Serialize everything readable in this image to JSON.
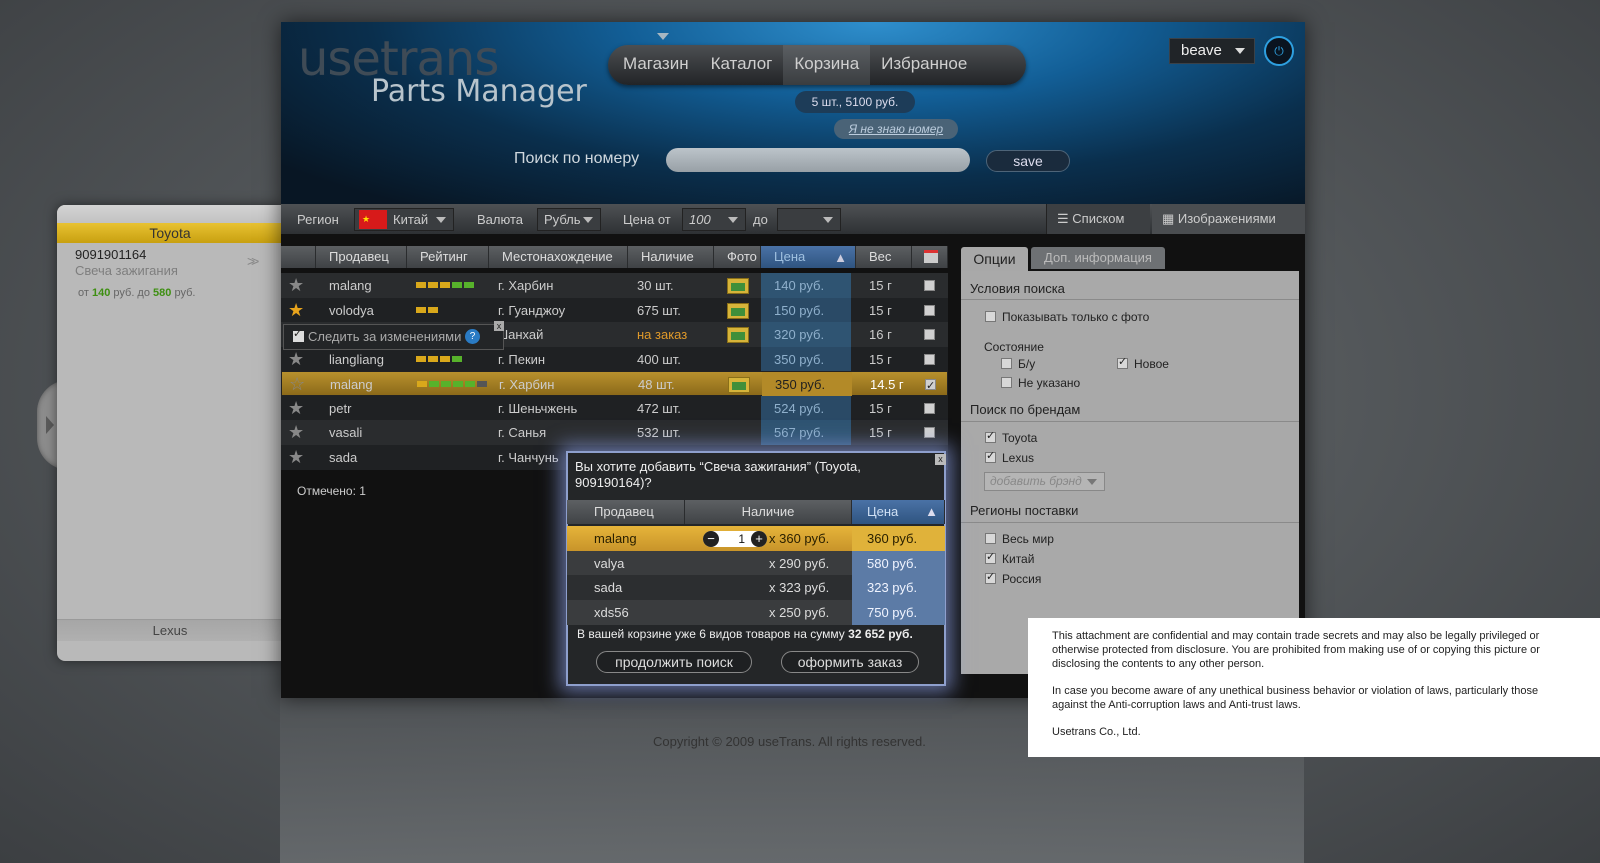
{
  "brand": {
    "logo_main": "usetrans",
    "logo_sub": "Parts Manager"
  },
  "nav": {
    "items": [
      "Магазин",
      "Каталог",
      "Корзина",
      "Избранное"
    ],
    "active": 2
  },
  "cart_summary": "5 шт., 5100 руб.",
  "dont_know_link": "Я не знаю номер",
  "search": {
    "label": "Поиск по номеру",
    "value": "",
    "button": "save"
  },
  "user": {
    "name": "beave"
  },
  "power_icon": "power-icon",
  "filters": {
    "region_label": "Регион",
    "region_value": "Китай",
    "currency_label": "Валюта",
    "currency_value": "Рубль",
    "price_from_label": "Цена от",
    "price_from_value": "100",
    "price_to_label": "до",
    "price_to_value": ""
  },
  "views": {
    "list": "Списком",
    "images": "Изображениями"
  },
  "results": {
    "columns": [
      "Продавец",
      "Рейтинг",
      "Местонахождение",
      "Наличие",
      "Фото",
      "Цена",
      "Вес"
    ],
    "rows": [
      {
        "seller": "malang",
        "rating": 5,
        "location": "г. Харбин",
        "stock": "30 шт.",
        "photo": true,
        "price": "140 руб.",
        "weight": "15 г",
        "checked": false,
        "fav": false
      },
      {
        "seller": "volodya",
        "rating": 2,
        "location": "г. Гуанджоу",
        "stock": "675 шт.",
        "photo": true,
        "price": "150 руб.",
        "weight": "15 г",
        "checked": false,
        "fav": true
      },
      {
        "seller": "",
        "rating": 0,
        "location": ". Шанхай",
        "stock": "на заказ",
        "photo": true,
        "price": "320 руб.",
        "weight": "16 г",
        "checked": false,
        "fav": false
      },
      {
        "seller": "liangliang",
        "rating": 4,
        "location": "г. Пекин",
        "stock": "400 шт.",
        "photo": false,
        "price": "350 руб.",
        "weight": "15 г",
        "checked": false,
        "fav": false
      },
      {
        "seller": "malang",
        "rating": 5,
        "location": "г. Харбин",
        "stock": "48 шт.",
        "photo": true,
        "price": "350 руб.",
        "weight": "14.5 г",
        "checked": true,
        "fav": false
      },
      {
        "seller": "petr",
        "rating": 0,
        "location": "г. Шеньчжень",
        "stock": "472 шт.",
        "photo": false,
        "price": "524 руб.",
        "weight": "15 г",
        "checked": false,
        "fav": false
      },
      {
        "seller": "vasali",
        "rating": 0,
        "location": "г. Санья",
        "stock": "532 шт.",
        "photo": false,
        "price": "567 руб.",
        "weight": "15 г",
        "checked": false,
        "fav": false
      },
      {
        "seller": "sada",
        "rating": 0,
        "location": "г. Чанчунь",
        "stock": "",
        "photo": false,
        "price": "",
        "weight": "",
        "checked": false,
        "fav": false
      }
    ],
    "marked_label": "Отмечено:",
    "marked_count": "1"
  },
  "watch": {
    "label": "Следить за изменениями",
    "help": "?",
    "close": "x"
  },
  "left_panel": {
    "brand": "Toyota",
    "part_number": "9091901164",
    "part_name": "Свеча зажигания",
    "price_from": "от",
    "price_min": "140",
    "price_mid": "руб. до",
    "price_max": "580",
    "price_unit": "руб.",
    "next_brand": "Lexus",
    "arrow": ">>"
  },
  "options": {
    "tabs": [
      "Опции",
      "Доп. информация"
    ],
    "search_conditions": "Условия поиска",
    "only_photo": "Показывать только с фото",
    "condition": "Состояние",
    "used": "Б/у",
    "new": "Новое",
    "unspecified": "Не указано",
    "brand_search": "Поиск по брендам",
    "brands": [
      "Toyota",
      "Lexus"
    ],
    "add_brand": "добавить брэнд",
    "regions": "Регионы поставки",
    "region_list": [
      "Весь мир",
      "Китай",
      "Россия"
    ]
  },
  "dialog": {
    "title": "Вы хотите добавить “Свеча зажигания” (Toyota, 909190164)?",
    "columns": [
      "Продавец",
      "Наличие",
      "Цена"
    ],
    "rows": [
      {
        "seller": "malang",
        "qty": "1",
        "unit": "x 360 руб.",
        "price": "360 руб."
      },
      {
        "seller": "valya",
        "unit": "x 290 руб.",
        "price": "580 руб."
      },
      {
        "seller": "sada",
        "unit": "x 323 руб.",
        "price": "323 руб."
      },
      {
        "seller": "xds56",
        "unit": "x 250 руб.",
        "price": "750 руб."
      }
    ],
    "summary_text": "В вашей корзине уже 6 видов товаров на сумму",
    "summary_total": "32 652 руб.",
    "continue": "продолжить поиск",
    "checkout": "оформить заказ",
    "close": "x"
  },
  "copyright": "Copyright © 2009 useTrans. All rights reserved.",
  "notice": {
    "p1": "This attachment are confidential and may contain trade secrets and may also be legally privileged or otherwise protected from disclosure. You are prohibited from making use of or copying this picture or disclosing the contents to any other person.",
    "p2": "In case you become aware of any unethical business behavior or violation of laws, particularly those against the Anti-corruption laws and Anti-trust laws.",
    "p3": "Usetrans Co., Ltd."
  }
}
